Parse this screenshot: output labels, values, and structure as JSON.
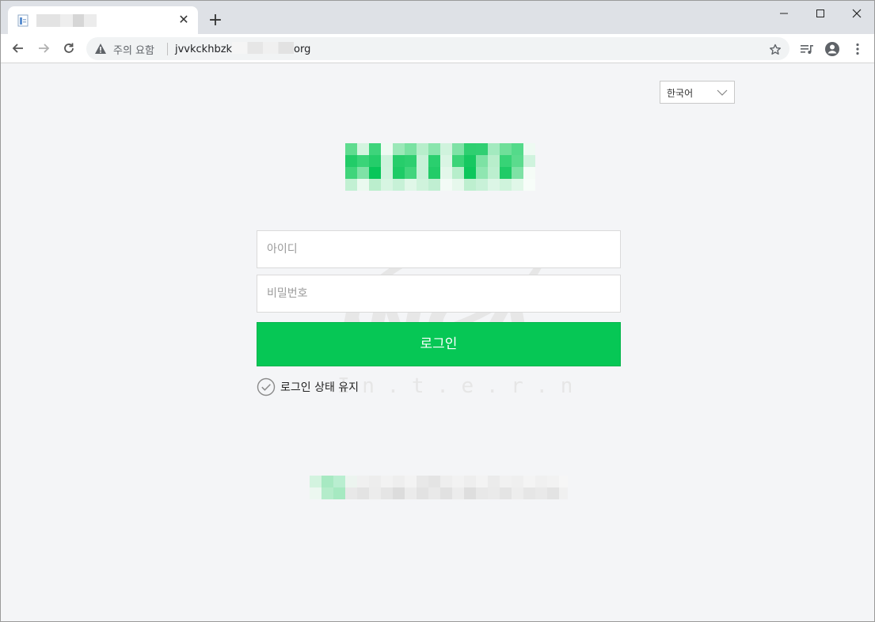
{
  "browser": {
    "tab_title": "",
    "address_warning": "주의 요함",
    "url_prefix": "jvvkckhbzk",
    "url_suffix": "org",
    "close_tab_glyph": "✕",
    "new_tab_glyph": "+",
    "icons": {
      "back": "arrow-left-icon",
      "forward": "arrow-right-icon",
      "reload": "reload-icon",
      "warning": "warning-triangle-icon",
      "bookmark": "star-icon",
      "media": "media-queue-icon",
      "profile": "account-circle-icon",
      "menu": "more-vertical-icon",
      "minimize": "minimize-icon",
      "maximize": "maximize-icon",
      "close": "close-icon"
    }
  },
  "page": {
    "language_select": {
      "selected": "한국어"
    },
    "login_form": {
      "id_placeholder": "아이디",
      "password_placeholder": "비밀번호",
      "submit_label": "로그인",
      "keep_logged_in_label": "로그인 상태 유지"
    },
    "watermark": {
      "brand": "INCA",
      "tagline": "I n . t . e . r . n . e . t"
    }
  },
  "colors": {
    "primary_green": "#06c755",
    "page_background": "#f4f5f7",
    "tabstrip_background": "#dee1e6"
  }
}
